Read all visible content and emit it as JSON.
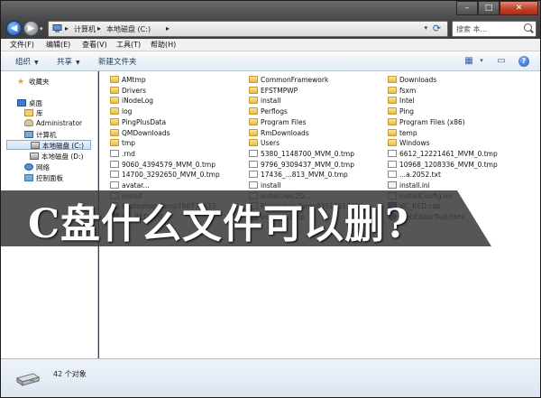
{
  "address": {
    "crumbs": [
      "计算机",
      "本地磁盘 (C:)"
    ],
    "separator": "▸"
  },
  "search": {
    "placeholder": "搜索 本..."
  },
  "menu": [
    "文件(F)",
    "编辑(E)",
    "查看(V)",
    "工具(T)",
    "帮助(H)"
  ],
  "toolbar": {
    "organize": "组织",
    "share": "共享",
    "new_folder": "新建文件夹"
  },
  "nav": {
    "favorites": "收藏夹",
    "desktop": "桌面",
    "library": "库",
    "user": "Administrator",
    "computer": "计算机",
    "drive_c": "本地磁盘 (C:)",
    "drive_d": "本地磁盘 (D:)",
    "network": "网络",
    "control_panel": "控制面板"
  },
  "files": [
    {
      "name": "AMtmp",
      "type": "folder"
    },
    {
      "name": "Drivers",
      "type": "folder"
    },
    {
      "name": "iNodeLog",
      "type": "folder"
    },
    {
      "name": "log",
      "type": "folder"
    },
    {
      "name": "PingPlusData",
      "type": "folder"
    },
    {
      "name": "QMDownloads",
      "type": "folder"
    },
    {
      "name": "tmp",
      "type": "folder"
    },
    {
      "name": ".rnd",
      "type": "doc"
    },
    {
      "name": "9060_4394579_MVM_0.tmp",
      "type": "doc"
    },
    {
      "name": "14700_3292650_MVM_0.tmp",
      "type": "doc"
    },
    {
      "name": "avatar...",
      "type": "doc"
    },
    {
      "name": "install",
      "type": "doc"
    },
    {
      "name": "Photoshop Temp780776612",
      "type": "doc"
    },
    {
      "name": "VC_RED.MSI",
      "type": "msi"
    },
    {
      "name": "CommonFramework",
      "type": "folder"
    },
    {
      "name": "EFSTMPWP",
      "type": "folder"
    },
    {
      "name": "install",
      "type": "folder"
    },
    {
      "name": "Perflogs",
      "type": "folder"
    },
    {
      "name": "Program Files",
      "type": "folder"
    },
    {
      "name": "RmDownloads",
      "type": "folder"
    },
    {
      "name": "Users",
      "type": "folder"
    },
    {
      "name": "5380_1148700_MVM_0.tmp",
      "type": "doc"
    },
    {
      "name": "9796_9309437_MVM_0.tmp",
      "type": "doc"
    },
    {
      "name": "17436_...813_MVM_0.tmp",
      "type": "doc"
    },
    {
      "name": "install",
      "type": "doc"
    },
    {
      "name": "install.res.20...",
      "type": "doc"
    },
    {
      "name": "Photoshop Temp93519517436",
      "type": "doc"
    },
    {
      "name": "vcredist.bmp",
      "type": "img"
    },
    {
      "name": "Downloads",
      "type": "folder"
    },
    {
      "name": "fsxm",
      "type": "folder"
    },
    {
      "name": "Intel",
      "type": "folder"
    },
    {
      "name": "Ping",
      "type": "folder"
    },
    {
      "name": "Program Files (x86)",
      "type": "folder"
    },
    {
      "name": "temp",
      "type": "folder"
    },
    {
      "name": "Windows",
      "type": "folder"
    },
    {
      "name": "6612_12221461_MVM_0.tmp",
      "type": "doc"
    },
    {
      "name": "10968_1208336_MVM_0.tmp",
      "type": "doc"
    },
    {
      "name": "...a.2052.txt",
      "type": "doc"
    },
    {
      "name": "install.ini",
      "type": "ini"
    },
    {
      "name": "InstallConfig.ini",
      "type": "ini"
    },
    {
      "name": "VC_RED.cab",
      "type": "cab"
    },
    {
      "name": "WebEditorTest.html",
      "type": "html"
    }
  ],
  "overlay_title": "C盘什么文件可以删?",
  "status": {
    "count_text": "42 个对象"
  }
}
